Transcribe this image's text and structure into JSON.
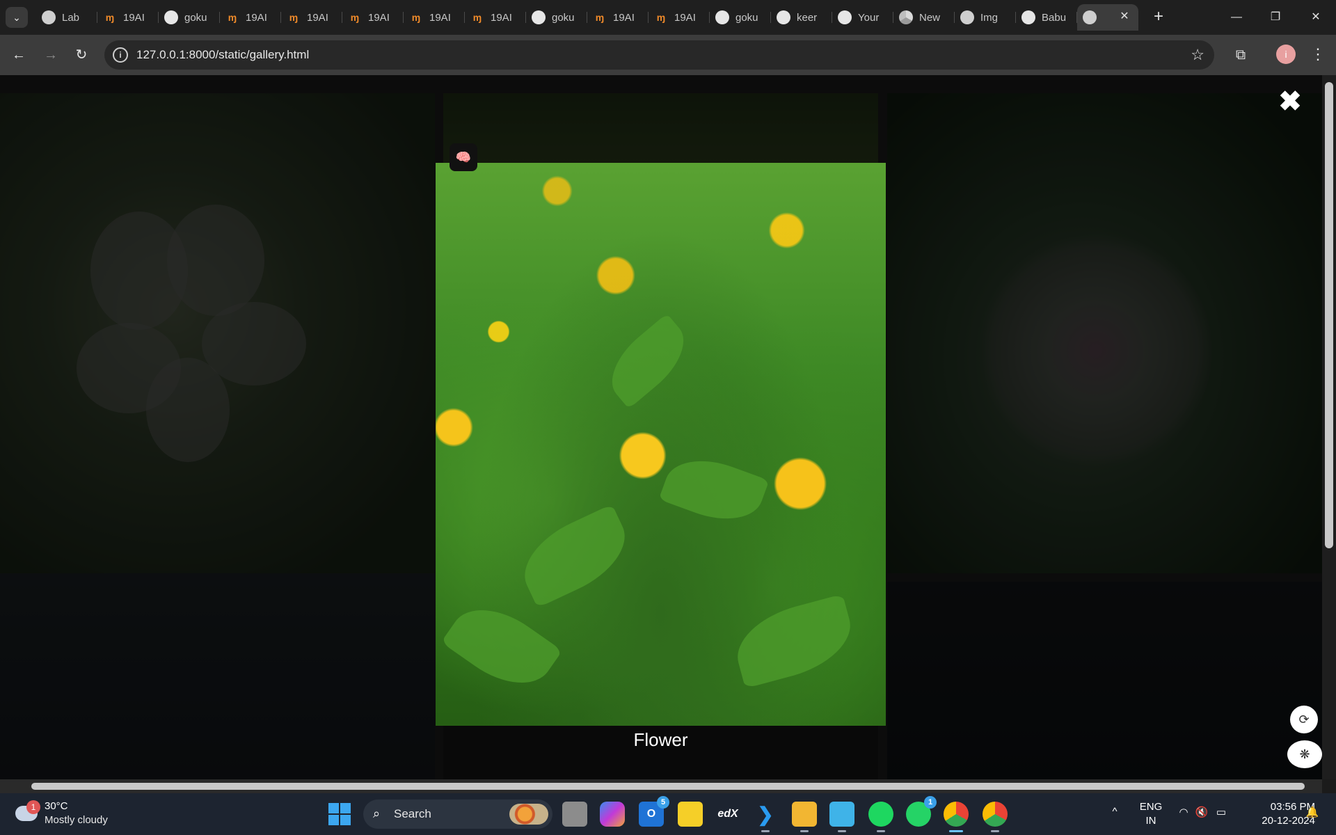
{
  "browser": {
    "tabs": [
      {
        "title": "Lab",
        "icon": "globe-icon"
      },
      {
        "title": "19AI",
        "icon": "in-icon"
      },
      {
        "title": "goku",
        "icon": "github-icon"
      },
      {
        "title": "19AI",
        "icon": "in-icon"
      },
      {
        "title": "19AI",
        "icon": "in-icon"
      },
      {
        "title": "19AI",
        "icon": "in-icon"
      },
      {
        "title": "19AI",
        "icon": "in-icon"
      },
      {
        "title": "19AI",
        "icon": "in-icon"
      },
      {
        "title": "goku",
        "icon": "github-icon"
      },
      {
        "title": "19AI",
        "icon": "in-icon"
      },
      {
        "title": "19AI",
        "icon": "in-icon"
      },
      {
        "title": "goku",
        "icon": "github-icon"
      },
      {
        "title": "keer",
        "icon": "github-icon"
      },
      {
        "title": "Your",
        "icon": "github-icon"
      },
      {
        "title": "New",
        "icon": "chrome-icon"
      },
      {
        "title": "Img",
        "icon": "globe-icon"
      },
      {
        "title": "Babu",
        "icon": "github-icon"
      },
      {
        "title": "",
        "icon": "globe-icon",
        "active": true
      }
    ],
    "url": "127.0.0.1:8000/static/gallery.html"
  },
  "gallery": {
    "caption": "Flower",
    "close_symbol": "✖"
  },
  "taskbar": {
    "weather": {
      "badge": "1",
      "temp": "30°C",
      "desc": "Mostly cloudy"
    },
    "search_label": "Search",
    "apps": [
      {
        "name": "task-view",
        "badge": ""
      },
      {
        "name": "copilot",
        "badge": ""
      },
      {
        "name": "outlook",
        "badge": "5"
      },
      {
        "name": "sticky-notes",
        "badge": ""
      },
      {
        "name": "edx",
        "label": "edX",
        "badge": ""
      },
      {
        "name": "vscode",
        "badge": ""
      },
      {
        "name": "file-explorer",
        "badge": ""
      },
      {
        "name": "notepad",
        "badge": ""
      },
      {
        "name": "spotify",
        "badge": ""
      },
      {
        "name": "whatsapp",
        "badge": "1"
      },
      {
        "name": "chrome-profile",
        "badge": ""
      },
      {
        "name": "chrome",
        "badge": ""
      }
    ],
    "language": {
      "line1": "ENG",
      "line2": "IN"
    },
    "clock": {
      "time": "03:56 PM",
      "date": "20-12-2024"
    }
  }
}
